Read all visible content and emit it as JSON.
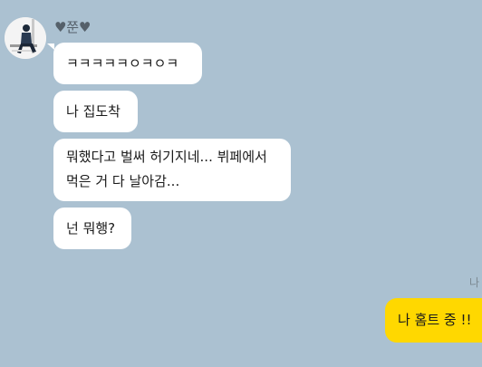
{
  "chat": {
    "sender": {
      "name": "♥쭌♥",
      "avatar_icon": "profile-silhouette-icon"
    },
    "received_messages": [
      {
        "lines": [
          "ㅋㅋㅋㅋㅋㅇㅋㅇㅋ"
        ]
      },
      {
        "lines": [
          "나 집도착"
        ]
      },
      {
        "lines": [
          "뭐했다고 벌써 허기지네... 뷔페에서",
          "먹은 거 다 날아감..."
        ]
      },
      {
        "lines": [
          "넌 뭐행?"
        ]
      }
    ],
    "sent_messages": [
      {
        "lines": [
          "나 홈트 중 !!"
        ],
        "read_marker": "나"
      }
    ],
    "colors": {
      "background": "#abc1d1",
      "received_bubble": "#ffffff",
      "sent_bubble": "#ffd800"
    }
  }
}
